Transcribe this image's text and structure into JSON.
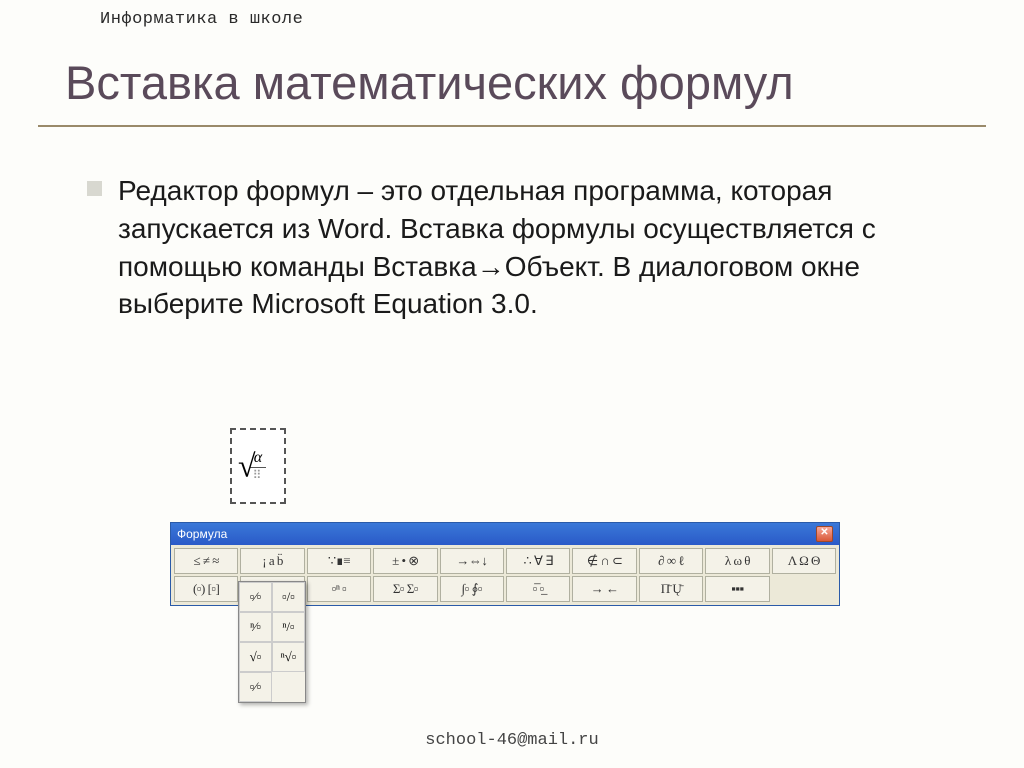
{
  "header": "Информатика в школе",
  "title": "Вставка математических формул",
  "body": "Редактор формул – это отдельная программа, которая запускается из Word. Вставка формулы осуществляется с помощью команды Вставка→Объект. В диалоговом окне выберите Microsoft Equation 3.0.",
  "equation_alpha": "α",
  "toolbar": {
    "title": "Формула",
    "close": "✕",
    "row1": [
      "≤ ≠ ≈",
      "¡ a b̈",
      "∵∎≡",
      "± • ⊗",
      "→⇔↓",
      "∴ ∀ ∃",
      "∉ ∩ ⊂",
      "∂ ∞ ℓ",
      "λ ω θ",
      "Λ Ω Θ"
    ],
    "row2": [
      "(▫) [▫]",
      "▫⁄▫ √▫",
      "▫ⁿ ▫",
      "Σ▫ Σ▫",
      "∫▫ ∮▫",
      "▫̅ ▫̲",
      "→ ←",
      "Π̄ Ų̄",
      "▪▪▪",
      ""
    ]
  },
  "dropdown": [
    [
      "▫⁄▫",
      "▫/▫"
    ],
    [
      "ⁿ⁄▫",
      "ⁿ/▫"
    ],
    [
      "√▫",
      "ⁿ√▫"
    ],
    [
      "▫⁄▫",
      ""
    ]
  ],
  "footer": "school-46@mail.ru"
}
